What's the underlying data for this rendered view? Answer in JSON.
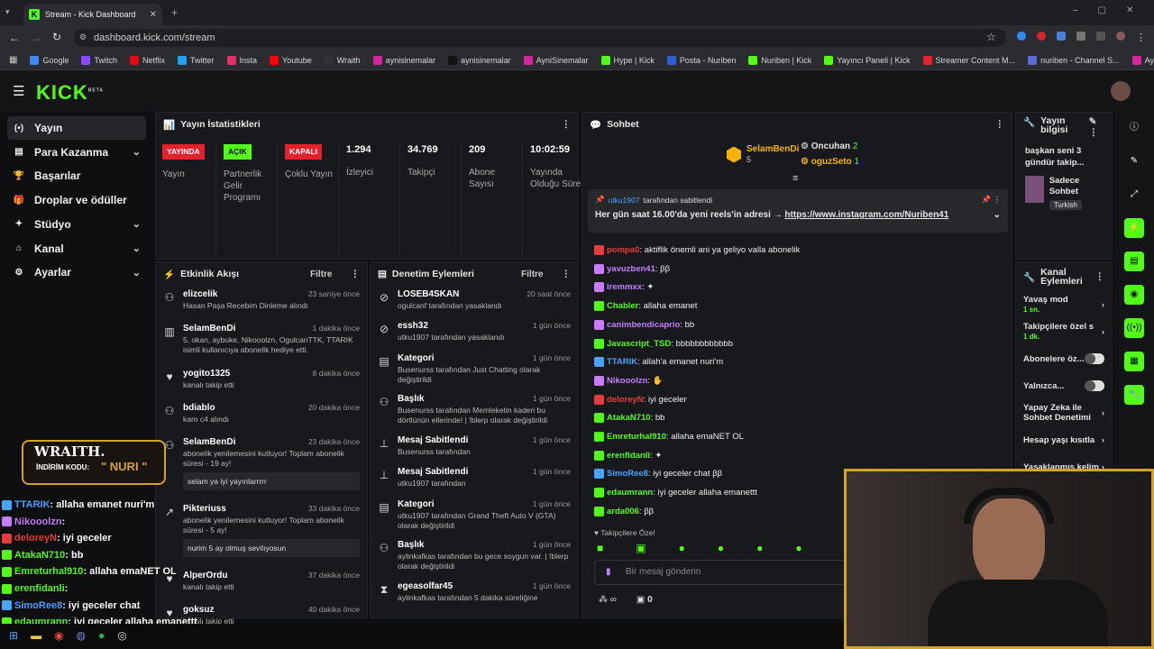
{
  "browser": {
    "tab_title": "Stream - Kick Dashboard",
    "url": "dashboard.kick.com/stream",
    "bookmarks": [
      "Google",
      "Twitch",
      "Netflix",
      "Twitter",
      "Insta",
      "Youtube",
      "Wraith",
      "aynisinemalar",
      "aynisinemalar",
      "AyniSinemalar",
      "Hype | Kick",
      "Posta - Nuriben",
      "Nuriben | Kick",
      "Yayıncı Paneli | Kick",
      "Streamer Content M...",
      "nuriben - Channel S...",
      "Aynı Sinemalar - Ça..."
    ]
  },
  "header": {
    "logo": "KICK",
    "beta": "BETA"
  },
  "sidebar": [
    {
      "label": "Yayın",
      "icon": "(•)",
      "active": true
    },
    {
      "label": "Para Kazanma",
      "icon": "▤",
      "chevron": true
    },
    {
      "label": "Başarılar",
      "icon": "🏆"
    },
    {
      "label": "Droplar ve ödüller",
      "icon": "🎁"
    },
    {
      "label": "Stüdyo",
      "icon": "✦",
      "chevron": true
    },
    {
      "label": "Kanal",
      "icon": "⌂",
      "chevron": true
    },
    {
      "label": "Ayarlar",
      "icon": "⚙",
      "chevron": true
    }
  ],
  "stats": {
    "title": "Yayın İstatistikleri",
    "badges": [
      {
        "badge": "YAYINDA",
        "label": "Yayın",
        "color": "#e5212c",
        "text": "#fff"
      },
      {
        "badge": "AÇIK",
        "label": "Partnerlik Gelir Programı",
        "color": "#53fc18",
        "text": "#000"
      },
      {
        "badge": "KAPALI",
        "label": "Çoklu Yayın",
        "color": "#e5212c",
        "text": "#fff"
      }
    ],
    "values": [
      {
        "value": "1.294",
        "label": "İzleyici"
      },
      {
        "value": "34.769",
        "label": "Takipçi"
      },
      {
        "value": "209",
        "label": "Abone Sayısı"
      },
      {
        "value": "10:02:59",
        "label": "Yayında Olduğu Süre"
      }
    ]
  },
  "activity": {
    "title": "Etkinlik Akışı",
    "filter": "Filtre",
    "items": [
      {
        "name": "elizcelik",
        "time": "23 saniye önce",
        "desc": "Hasan Paşa Recebim Dinleme alındı"
      },
      {
        "name": "SelamBenDi",
        "time": "1 dakika önce",
        "desc": "5, okan, aybuke, Nikooolzn, OgulcanTTK, TTARIK isimli kullanıcıya abonelik hediye etti."
      },
      {
        "name": "yogito1325",
        "time": "8 dakika önce",
        "desc": "kanalı takip etti"
      },
      {
        "name": "bdiablo",
        "time": "20 dakika önce",
        "desc": "karo c4 alındı"
      },
      {
        "name": "SelamBenDi",
        "time": "23 dakika önce",
        "desc": "abonelik yenilemesini kutluyor! Toplam abonelik süresi - 19 ay!",
        "quote": "selam ya iyi yayınlarrrrr"
      },
      {
        "name": "Pikteriuss",
        "time": "33 dakika önce",
        "desc": "abonelik yenilemesini kutluyor! Toplam abonelik süresi - 5 ay!",
        "quote": "nurim 5 ay olmuş sevilıyosun"
      },
      {
        "name": "AlperOrdu",
        "time": "37 dakika önce",
        "desc": "kanalı takip etti"
      },
      {
        "name": "goksuz",
        "time": "40 dakika önce",
        "desc": "kanalı takip etti"
      }
    ]
  },
  "moderation": {
    "title": "Denetim Eylemleri",
    "filter": "Filtre",
    "items": [
      {
        "name": "LOSEB4SKAN",
        "time": "20 saat önce",
        "desc": "ogulcanf tarafından yasaklandı"
      },
      {
        "name": "essh32",
        "time": "1 gün önce",
        "desc": "utku1907 tarafından yasaklandı"
      },
      {
        "name": "Kategori",
        "time": "1 gün önce",
        "desc": "Busenurss tarafından Just Chatting olarak değiştirildi"
      },
      {
        "name": "Başlık",
        "time": "1 gün önce",
        "desc": "Busenurss tarafından Memleketin kaderi bu dörtlünün ellerinde! | !blerp olarak değiştirildi"
      },
      {
        "name": "Mesaj Sabitlendi",
        "time": "1 gün önce",
        "desc": "Busenurss tarafından"
      },
      {
        "name": "Mesaj Sabitlendi",
        "time": "1 gün önce",
        "desc": "utku1907 tarafından"
      },
      {
        "name": "Kategori",
        "time": "1 gün önce",
        "desc": "utku1907 tarafından Grand Theft Auto V (GTA) olarak değiştirildi"
      },
      {
        "name": "Başlık",
        "time": "1 gün önce",
        "desc": "aylinkafkas tarafından bu gece soygun var. | !blerp olarak değiştirildi"
      },
      {
        "name": "egeasolfar45",
        "time": "1 gün önce",
        "desc": "aylinkafkas tarafından 5 dakika süreliğine"
      }
    ]
  },
  "chat": {
    "title": "Sohbet",
    "top": [
      {
        "name": "SelamBenDi",
        "count": "5"
      },
      {
        "name": "Oncuhan",
        "count": "2"
      },
      {
        "name": "oguzSeto",
        "count": "1"
      }
    ],
    "pinned_by": "utku1907",
    "pinned_suffix": "tarafından sabitlendi",
    "pinned_text": "Her gün saat 16.00'da yeni reels'in adresi →",
    "pinned_link": "https://www.instagram.com/Nuriben41",
    "messages": [
      {
        "user": "pompa0",
        "color": "#e83b3b",
        "text": ": aktiflik önemli ani ya geliyo valla abonelik"
      },
      {
        "user": "yavuzben41",
        "color": "#c77dff",
        "text": ": ββ"
      },
      {
        "user": "iremmxx",
        "color": "#c77dff",
        "text": ": ✦"
      },
      {
        "user": "Chabler",
        "color": "#53fc18",
        "text": ": allaha emanet"
      },
      {
        "user": "canimbendicaprio",
        "color": "#c77dff",
        "text": ": bb"
      },
      {
        "user": "Javascript_TSD",
        "color": "#53fc18",
        "text": ": bbbbbbbbbbbb"
      },
      {
        "user": "TTARIK",
        "color": "#4aa3ff",
        "text": ": allah'a emanet nuri'm"
      },
      {
        "user": "Nikooolzn",
        "color": "#c77dff",
        "text": ": ✋"
      },
      {
        "user": "deloreyN",
        "color": "#e83b3b",
        "text": ": iyi geceler"
      },
      {
        "user": "AtakaN710",
        "color": "#53fc18",
        "text": ": bb"
      },
      {
        "user": "Emreturhal910",
        "color": "#53fc18",
        "text": ": allaha emaNET OL"
      },
      {
        "user": "erenfidanli",
        "color": "#53fc18",
        "text": ": ✦"
      },
      {
        "user": "SimoRee8",
        "color": "#4aa3ff",
        "text": ": iyi geceler chat ββ"
      },
      {
        "user": "edaumrann",
        "color": "#53fc18",
        "text": ": iyi geceler allaha emanettt"
      },
      {
        "user": "arda006",
        "color": "#53fc18",
        "text": ": ββ"
      }
    ],
    "followers_only": "Takipçilere Özel",
    "input_placeholder": "Bir mesaj gönderin",
    "points": "0"
  },
  "stream_info": {
    "title": "Yayın bilgisi",
    "stream_title": "başkan seni 3 gündür takip...",
    "category": "Sadece Sohbet",
    "tag": "Turkish"
  },
  "channel_actions": {
    "title": "Kanal Eylemleri",
    "items": [
      {
        "label": "Yavaş mod",
        "sub": "1 sn."
      },
      {
        "label": "Takipçilere özel s",
        "sub": "1 dk."
      },
      {
        "label": "Abonelere öz...",
        "toggle": true
      },
      {
        "label": "Yalnızca...",
        "toggle": true
      },
      {
        "label": "Yapay Zeka ile Sohbet Denetimi"
      },
      {
        "label": "Hesap yaşı kısıtla"
      },
      {
        "label": "Yasaklanmış kelim"
      }
    ]
  },
  "overlay": {
    "promo_name": "WRAITH.",
    "promo_code_label": "İNDİRİM KODU:",
    "promo_code": "NURI",
    "chat": [
      {
        "user": "TTARIK",
        "color": "#4aa3ff",
        "text": ": allaha emanet nuri'm"
      },
      {
        "user": "Nikooolzn",
        "color": "#c77dff",
        "text": ":"
      },
      {
        "user": "deloreyN",
        "color": "#e83b3b",
        "text": ": iyi geceler"
      },
      {
        "user": "AtakaN710",
        "color": "#53fc18",
        "text": ": bb"
      },
      {
        "user": "Emreturhal910",
        "color": "#53fc18",
        "text": ": allaha emaNET OL"
      },
      {
        "user": "erenfidanli",
        "color": "#53fc18",
        "text": ":"
      },
      {
        "user": "SimoRee8",
        "color": "#4aa3ff",
        "text": ": iyi geceler chat"
      },
      {
        "user": "edaumrann",
        "color": "#53fc18",
        "text": ": iyi geceler allaha emanettt"
      },
      {
        "user": "arda006",
        "color": "#4aa3ff",
        "text": ":"
      }
    ]
  }
}
